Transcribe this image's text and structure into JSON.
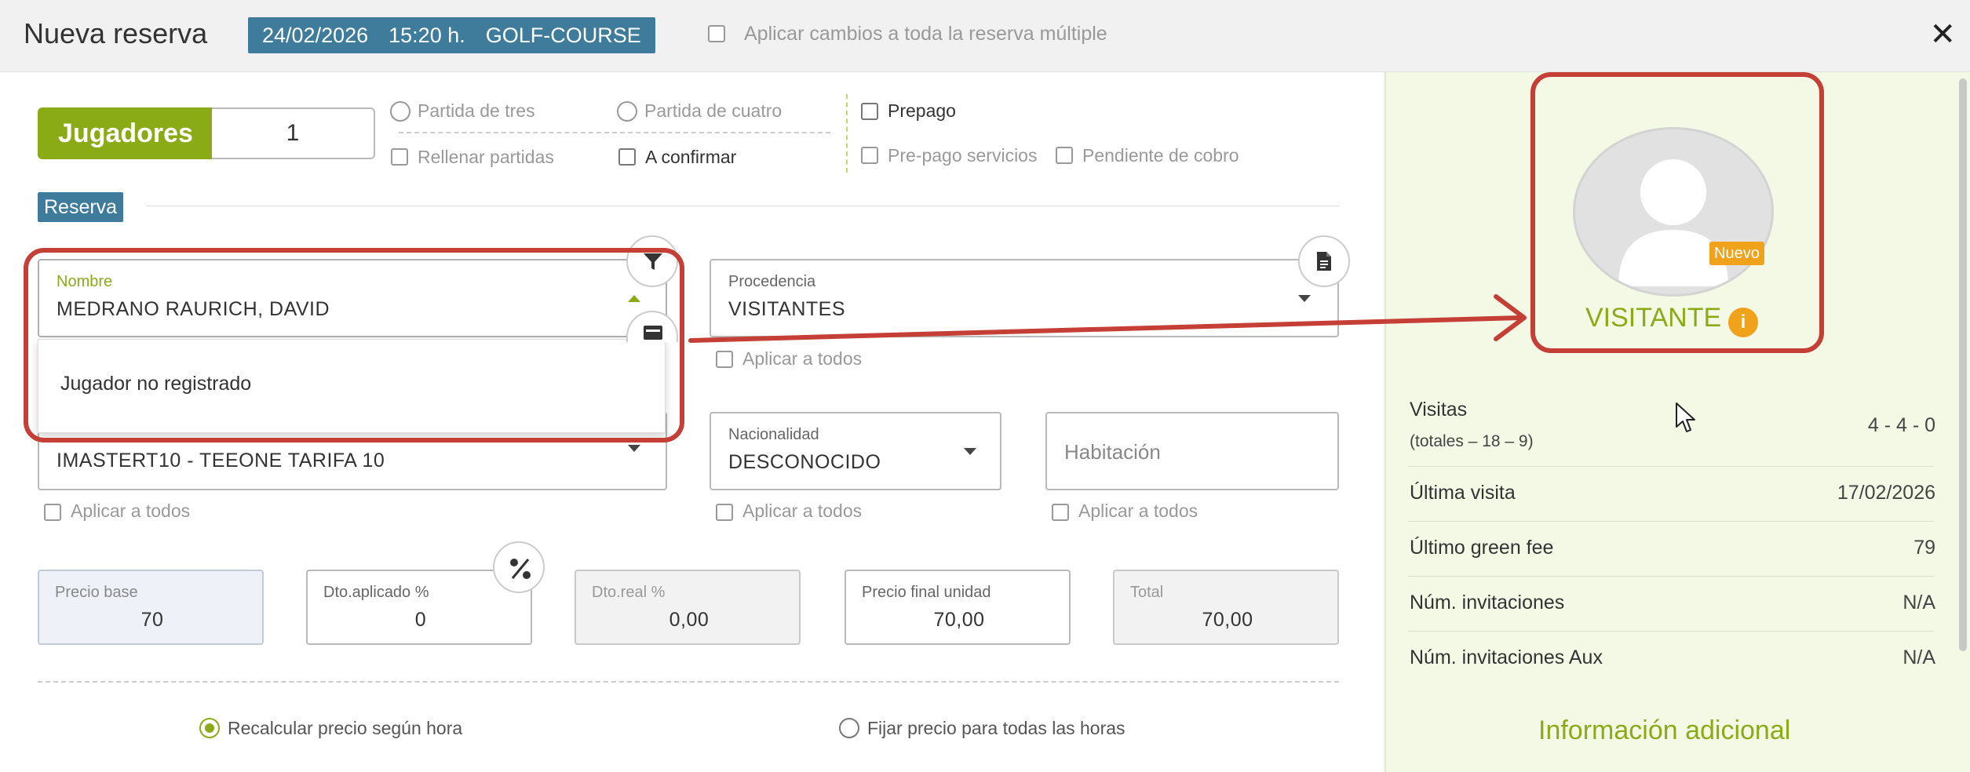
{
  "header": {
    "title": "Nueva reserva",
    "chip": {
      "date": "24/02/2026",
      "time": "15:20 h.",
      "course": "GOLF-COURSE"
    },
    "apply_all_label": "Aplicar cambios a toda la reserva múltiple",
    "close_symbol": "✕"
  },
  "players": {
    "label": "Jugadores",
    "count": "1",
    "options": {
      "partida_tres": "Partida de tres",
      "partida_cuatro": "Partida de cuatro",
      "rellenar": "Rellenar partidas",
      "a_confirmar": "A confirmar",
      "prepago": "Prepago",
      "prepago_servicios": "Pre-pago servicios",
      "pendiente_cobro": "Pendiente de cobro"
    }
  },
  "section_tag": "Reserva",
  "fields": {
    "nombre": {
      "label": "Nombre",
      "value": "MEDRANO RAURICH, DAVID"
    },
    "dropdown_option": "Jugador no registrado",
    "procedencia": {
      "label": "Procedencia",
      "value": "VISITANTES"
    },
    "green_fee": {
      "value": "IMASTERT10 - TEEONE TARIFA 10"
    },
    "nacionalidad": {
      "label": "Nacionalidad",
      "value": "DESCONOCIDO"
    },
    "habitacion": {
      "placeholder": "Habitación"
    },
    "apply_all": "Aplicar a todos"
  },
  "prices": {
    "precio_base": {
      "label": "Precio base",
      "value": "70"
    },
    "dto_aplicado": {
      "label": "Dto.aplicado %",
      "value": "0"
    },
    "dto_real": {
      "label": "Dto.real %",
      "value": "0,00"
    },
    "precio_final": {
      "label": "Precio final unidad",
      "value": "70,00"
    },
    "total": {
      "label": "Total",
      "value": "70,00"
    }
  },
  "pricing_mode": {
    "recalcular": "Recalcular precio según hora",
    "fijar": "Fijar precio para todas las horas",
    "selected": "recalcular"
  },
  "profile": {
    "badge": "Nuevo",
    "type": "VISITANTE",
    "info_symbol": "i",
    "stats": [
      {
        "label": "Visitas",
        "sublabel": "(totales – 18 – 9)",
        "value": "4 - 4 - 0"
      },
      {
        "label": "Última visita",
        "value": "17/02/2026"
      },
      {
        "label": "Último green fee",
        "value": "79"
      },
      {
        "label": "Núm. invitaciones",
        "value": "N/A"
      },
      {
        "label": "Núm. invitaciones Aux",
        "value": "N/A"
      }
    ],
    "more_info": "Información adicional"
  },
  "colors": {
    "accent_green": "#8aab16",
    "header_blue": "#3f7c9b",
    "annotation_red": "#c53f37",
    "badge_orange": "#f1a21b"
  }
}
